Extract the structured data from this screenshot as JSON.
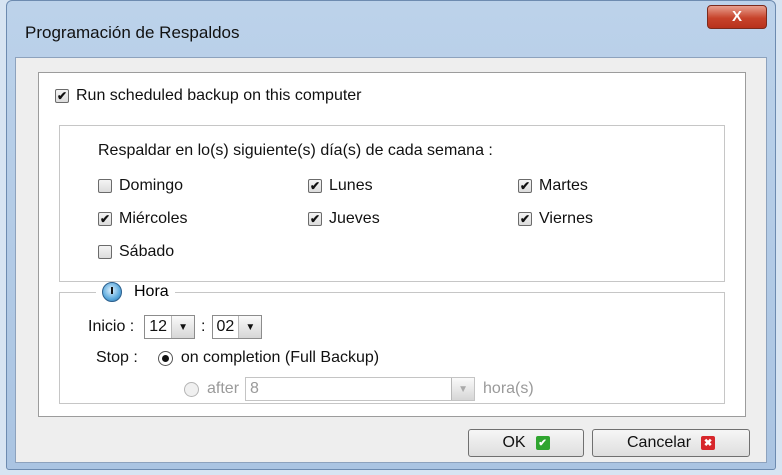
{
  "window": {
    "title": "Programación de Respaldos",
    "close_glyph": "X"
  },
  "run_scheduled": {
    "label": "Run scheduled backup on this computer",
    "checked": true
  },
  "days": {
    "heading": "Respaldar en lo(s) siguiente(s) día(s) de cada semana :",
    "items": [
      {
        "label": "Domingo",
        "checked": false
      },
      {
        "label": "Lunes",
        "checked": true
      },
      {
        "label": "Martes",
        "checked": true
      },
      {
        "label": "Miércoles",
        "checked": true
      },
      {
        "label": "Jueves",
        "checked": true
      },
      {
        "label": "Viernes",
        "checked": true
      },
      {
        "label": "Sábado",
        "checked": false
      }
    ]
  },
  "hora": {
    "legend": "Hora",
    "inicio_label": "Inicio :",
    "hour": "12",
    "separator": ":",
    "minute": "02",
    "stop_label": "Stop :",
    "on_completion_label": "on completion (Full Backup)",
    "after_label": "after",
    "after_value": "8",
    "after_unit": "hora(s)"
  },
  "buttons": {
    "ok": "OK",
    "cancel": "Cancelar"
  }
}
